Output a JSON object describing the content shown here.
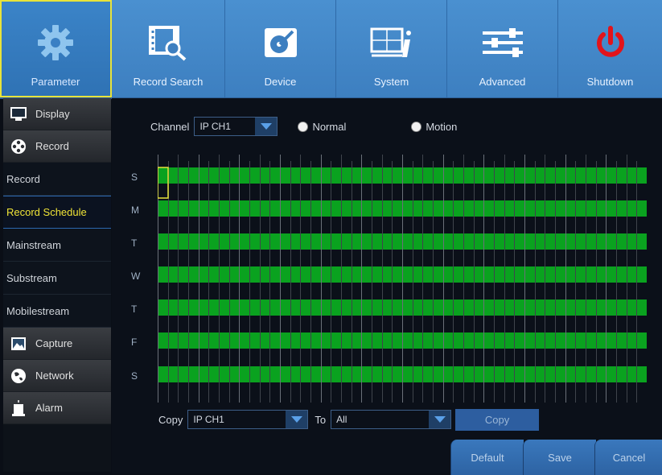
{
  "top_tabs": [
    {
      "label": "Parameter",
      "icon": "gear-icon",
      "active": true
    },
    {
      "label": "Record Search",
      "icon": "film-search-icon"
    },
    {
      "label": "Device",
      "icon": "hard-disk-icon"
    },
    {
      "label": "System",
      "icon": "monitor-info-icon"
    },
    {
      "label": "Advanced",
      "icon": "sliders-icon"
    },
    {
      "label": "Shutdown",
      "icon": "power-icon"
    }
  ],
  "sidebar": {
    "categories": {
      "display": "Display",
      "record": "Record",
      "capture": "Capture",
      "network": "Network",
      "alarm": "Alarm"
    },
    "record_items": [
      "Record",
      "Record Schedule",
      "Mainstream",
      "Substream",
      "Mobilestream"
    ],
    "active_item": "Record Schedule"
  },
  "schedule": {
    "channel_label": "Channel",
    "channel_value": "IP CH1",
    "mode_normal": "Normal",
    "mode_motion": "Motion",
    "days": [
      "S",
      "M",
      "T",
      "W",
      "T",
      "F",
      "S"
    ]
  },
  "copy": {
    "copy_label": "Copy",
    "from_value": "IP CH1",
    "to_label": "To",
    "to_value": "All",
    "copy_button": "Copy"
  },
  "footer": {
    "default": "Default",
    "save": "Save",
    "cancel": "Cancel"
  },
  "colors": {
    "accent": "#3d7fc0",
    "schedule_green": "#0aa21f",
    "active_text": "#f0e436"
  }
}
